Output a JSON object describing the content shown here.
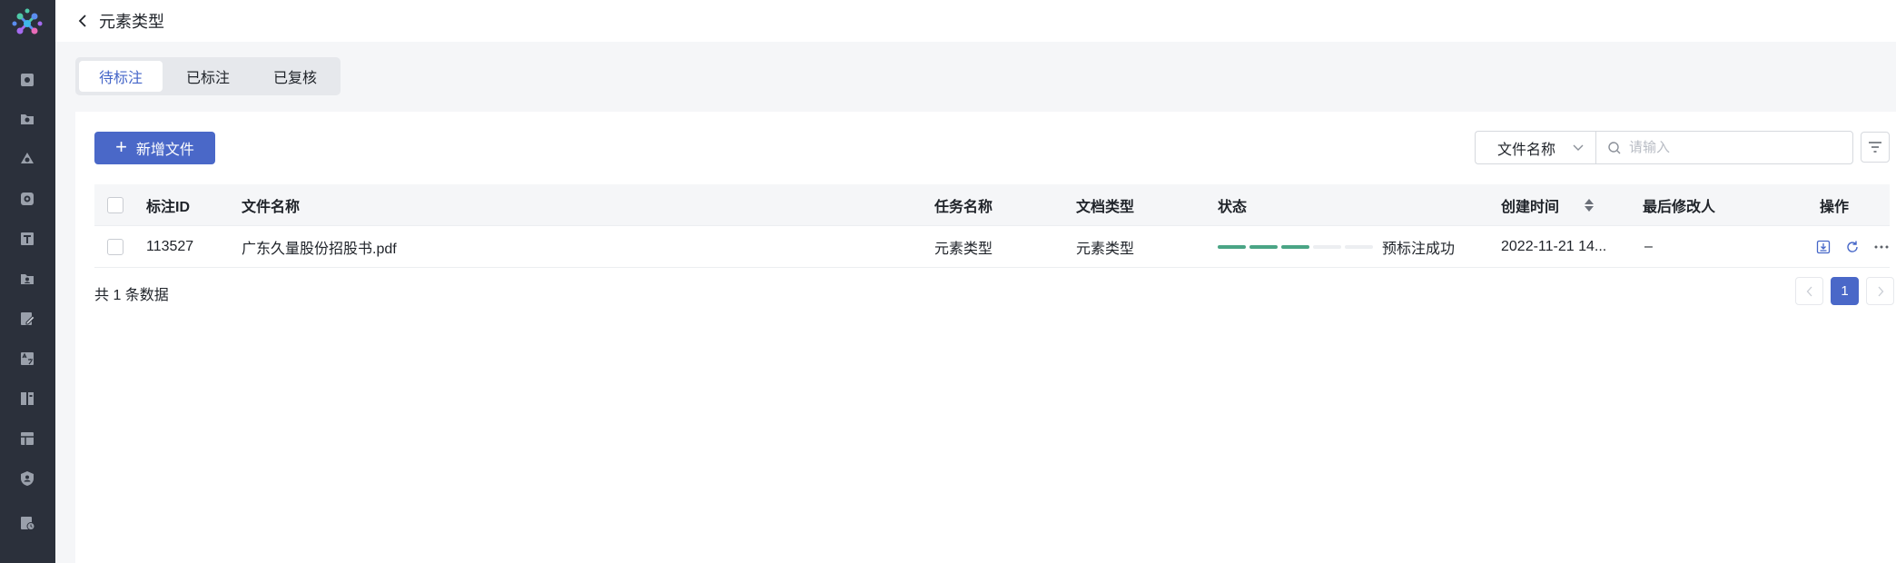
{
  "header": {
    "title": "元素类型"
  },
  "sidebar": {
    "items": [
      {
        "icon": "settings-box-icon"
      },
      {
        "icon": "folder-gear-icon"
      },
      {
        "icon": "shapes-icon"
      },
      {
        "icon": "badge-icon"
      },
      {
        "icon": "text-icon"
      },
      {
        "icon": "folder-person-icon"
      },
      {
        "icon": "annotate-icon"
      },
      {
        "icon": "translate-icon"
      },
      {
        "icon": "book-icon"
      },
      {
        "icon": "table-icon"
      },
      {
        "icon": "shield-user-icon"
      },
      {
        "icon": "doc-history-icon"
      }
    ]
  },
  "tabs": [
    {
      "label": "待标注",
      "active": true
    },
    {
      "label": "已标注",
      "active": false
    },
    {
      "label": "已复核",
      "active": false
    }
  ],
  "toolbar": {
    "add_label": "新增文件",
    "search_field": "文件名称",
    "search_placeholder": "请输入"
  },
  "table": {
    "columns": [
      "标注ID",
      "文件名称",
      "任务名称",
      "文档类型",
      "状态",
      "创建时间",
      "最后修改人",
      "操作"
    ],
    "rows": [
      {
        "id": "113527",
        "file": "广东久量股份招股书.pdf",
        "task": "元素类型",
        "doc_type": "元素类型",
        "status": "预标注成功",
        "progress_steps": 5,
        "progress_done": 3,
        "created": "2022-11-21 14...",
        "modifier": "–"
      }
    ]
  },
  "footer": {
    "total": "共 1 条数据",
    "page": "1"
  },
  "colors": {
    "sidebar": "#2b303b",
    "primary": "#4a68c8",
    "progress": "#4aa585"
  }
}
